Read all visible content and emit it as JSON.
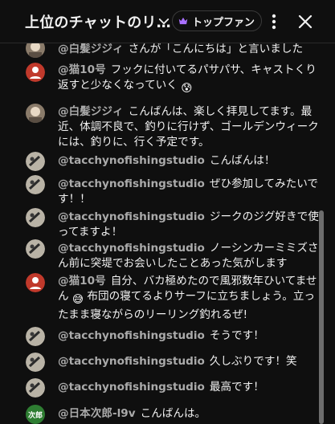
{
  "header": {
    "title": "上位のチャットのリ…",
    "fan_badge": "トップファン",
    "icons": {
      "dropdown": "chevron-down-icon",
      "badge": "crown-icon",
      "more": "kebab-icon",
      "close": "close-icon"
    }
  },
  "messages": [
    {
      "author": "@白髪ジジィ",
      "text": "さんが「こんにちは」と言いました",
      "avatar": "photo"
    },
    {
      "author": "@猫10号",
      "text": "フックに付いてるパサパサ、キャストくり返すと少なくなっていく",
      "emoji": "😰",
      "avatar": "red-user"
    },
    {
      "author": "@白髪ジジィ",
      "text": "こんばんは、楽しく拝見してます。最近、体調不良で、釣りに行けず、ゴールデンウィークには、釣りに、行く予定です。",
      "avatar": "photo"
    },
    {
      "author": "@tacchynofishingstudio",
      "text": "こんばんは！",
      "avatar": "fish"
    },
    {
      "author": "@tacchynofishingstudio",
      "text": "ぜひ参加してみたいです！！",
      "avatar": "fish"
    },
    {
      "author": "@tacchynofishingstudio",
      "text": "ジークのジグ好きで使ってますよ！",
      "avatar": "fish"
    },
    {
      "author": "@tacchynofishingstudio",
      "text": "ノーシンカーミミズさん前に突堤でお会いしたことあった気がします",
      "avatar": "fish"
    },
    {
      "author": "@猫10号",
      "text_a": "自分、バカ極めたので風邪数年ひいてません",
      "emoji": "😅",
      "text_b": "布団の寝てるよりサーフに立ちましょう。立ったまま寝ながらのリーリング釣れるぜ!",
      "avatar": "red-user"
    },
    {
      "author": "@tacchynofishingstudio",
      "text": "そうです！",
      "avatar": "fish"
    },
    {
      "author": "@tacchynofishingstudio",
      "text": "久しぶりです！笑",
      "avatar": "fish"
    },
    {
      "author": "@tacchynofishingstudio",
      "text": "最高です！",
      "avatar": "fish"
    },
    {
      "author": "@日本次郎-l9v",
      "text": "こんばんは。",
      "avatar_text": "次郎",
      "avatar": "green"
    }
  ],
  "colors": {
    "background": "#0f0f0f",
    "author": "#aaaaaa",
    "text": "#f1f1f1",
    "crown": "#a970ff",
    "red_avatar": "#c0392b",
    "green_avatar": "#2e7d32"
  }
}
